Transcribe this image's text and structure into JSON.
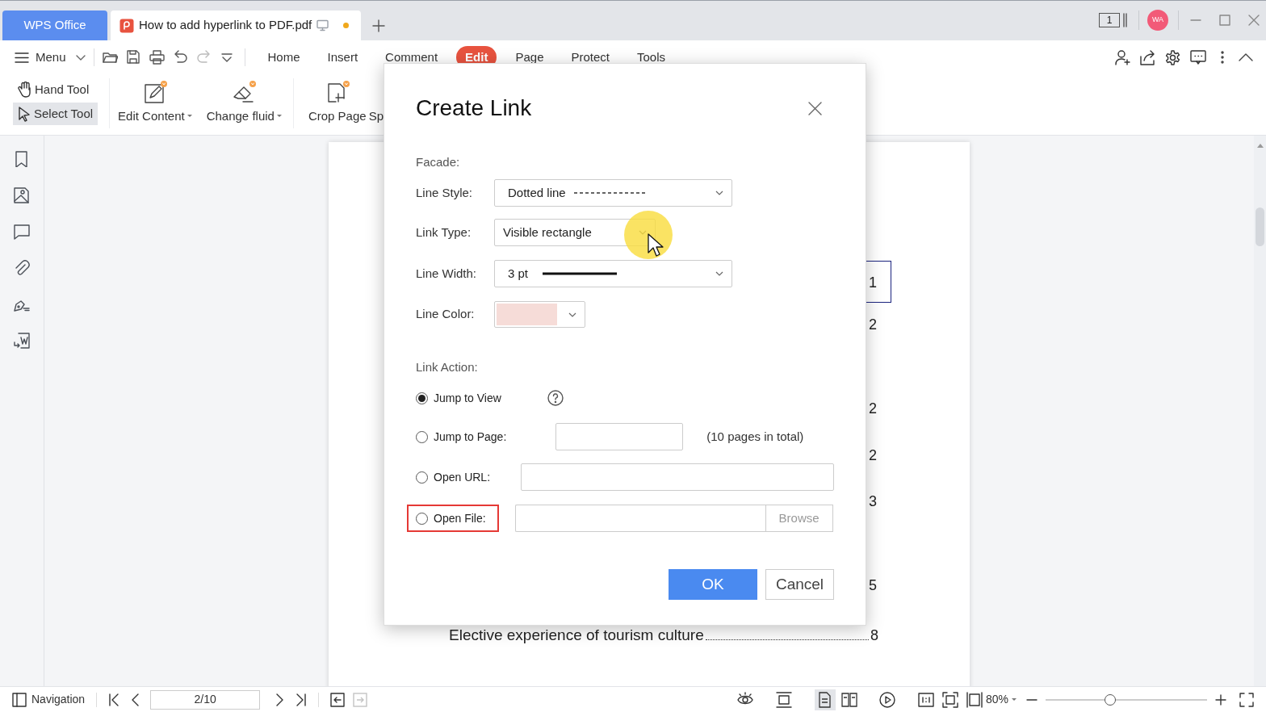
{
  "tabs": [
    {
      "label": "WPS Office",
      "kind": "home",
      "selected": false
    },
    {
      "label": "How to add hyperlink to PDF.pdf",
      "kind": "document",
      "selected": true,
      "unsaved": true
    }
  ],
  "account": {
    "initials": "WA"
  },
  "window_count": "1",
  "ribbon": {
    "menu": "Menu",
    "tabs": [
      {
        "label": "Home",
        "selected": false
      },
      {
        "label": "Insert",
        "selected": false
      },
      {
        "label": "Comment",
        "selected": false
      },
      {
        "label": "Edit",
        "selected": true
      },
      {
        "label": "Page",
        "selected": false
      },
      {
        "label": "Protect",
        "selected": false
      },
      {
        "label": "Tools",
        "selected": false
      }
    ],
    "select_tools": [
      {
        "label": "Hand Tool",
        "kind": "hand",
        "selected": false
      },
      {
        "label": "Select Tool",
        "kind": "select",
        "selected": true
      }
    ],
    "tools": [
      {
        "label": "Edit Content",
        "kind": "edit",
        "dropdown": true,
        "premium": true
      },
      {
        "label": "Change fluid",
        "kind": "eraser",
        "dropdown": true,
        "premium": true
      },
      {
        "label": "Crop Page",
        "kind": "crop",
        "dropdown": false,
        "premium": true
      },
      {
        "label": "Sp",
        "kind": "cut",
        "dropdown": false,
        "premium": false
      }
    ]
  },
  "document": {
    "page_numbers": [
      "1",
      "2",
      "2",
      "2",
      "3",
      "5"
    ],
    "last_entry": {
      "title": "Elective experience of tourism culture",
      "page": "8"
    }
  },
  "dialog": {
    "title": "Create Link",
    "facade": "Facade:",
    "line_style": {
      "label": "Line Style:",
      "value": "Dotted line"
    },
    "link_type": {
      "label": "Link Type:",
      "value": "Visible rectangle"
    },
    "line_width": {
      "label": "Line Width:",
      "value": "3 pt"
    },
    "line_color": {
      "label": "Line Color:",
      "color": "#f6dcd8"
    },
    "link_action": "Link Action:",
    "actions": [
      {
        "label": "Jump to View",
        "kind": "view",
        "selected": true,
        "highlighted": false
      },
      {
        "label": "Jump to Page:",
        "kind": "page",
        "selected": false,
        "highlighted": false,
        "note": "(10 pages in total)"
      },
      {
        "label": "Open URL:",
        "kind": "url",
        "selected": false,
        "highlighted": false
      },
      {
        "label": "Open File:",
        "kind": "file",
        "selected": false,
        "highlighted": true,
        "button": "Browse"
      }
    ],
    "ok": "OK",
    "cancel": "Cancel"
  },
  "status_bar": {
    "navigation": "Navigation",
    "page": "2/10",
    "zoom": "80%",
    "zoom_slider": {
      "level": 0.4
    },
    "view_modes": [
      {
        "kind": "single",
        "selected": true
      },
      {
        "kind": "double",
        "selected": false
      }
    ],
    "forward_disabled": true
  }
}
